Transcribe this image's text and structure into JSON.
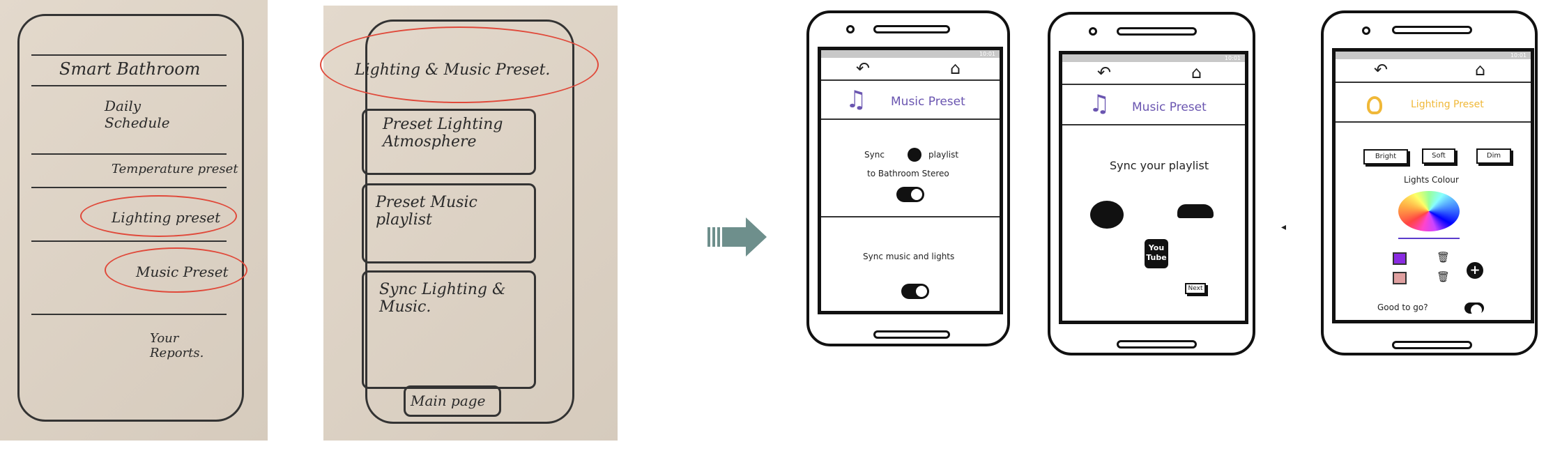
{
  "sketch1": {
    "title": "Smart Bathroom",
    "items": [
      "Daily Schedule",
      "Temperature preset",
      "Lighting preset",
      "Music Preset",
      "Your Reports."
    ]
  },
  "sketch2": {
    "title": "Lighting & Music Preset.",
    "items": [
      "Preset Lighting Atmosphere",
      "Preset Music playlist",
      "Sync Lighting & Music.",
      "Main page"
    ]
  },
  "status_time": "10:01",
  "colors": {
    "music": "#6a55b0",
    "lighting": "#f0b838",
    "arrow": "#6e8f8c",
    "swatch1": "#8a2be2",
    "swatch2": "#e0a0a0"
  },
  "phone1": {
    "title": "Music Preset",
    "sync_prefix": "Sync",
    "sync_suffix": "playlist",
    "sync_line2": "to Bathroom Stereo",
    "sync_toggle_on": true,
    "sync_lights_label": "Sync music and lights",
    "sync_lights_toggle_on": true
  },
  "phone2": {
    "title": "Music Preset",
    "heading": "Sync your playlist",
    "services": [
      "spotify-icon",
      "soundcloud-icon",
      "youtube-icon"
    ],
    "youtube_you": "You",
    "youtube_tube": "Tube",
    "next_label": "Next"
  },
  "phone3": {
    "title": "Lighting Preset",
    "modes": [
      "Bright",
      "Soft",
      "Dim"
    ],
    "colour_label": "Lights Colour",
    "good_label": "Good to go?",
    "good_toggle_on": true
  }
}
